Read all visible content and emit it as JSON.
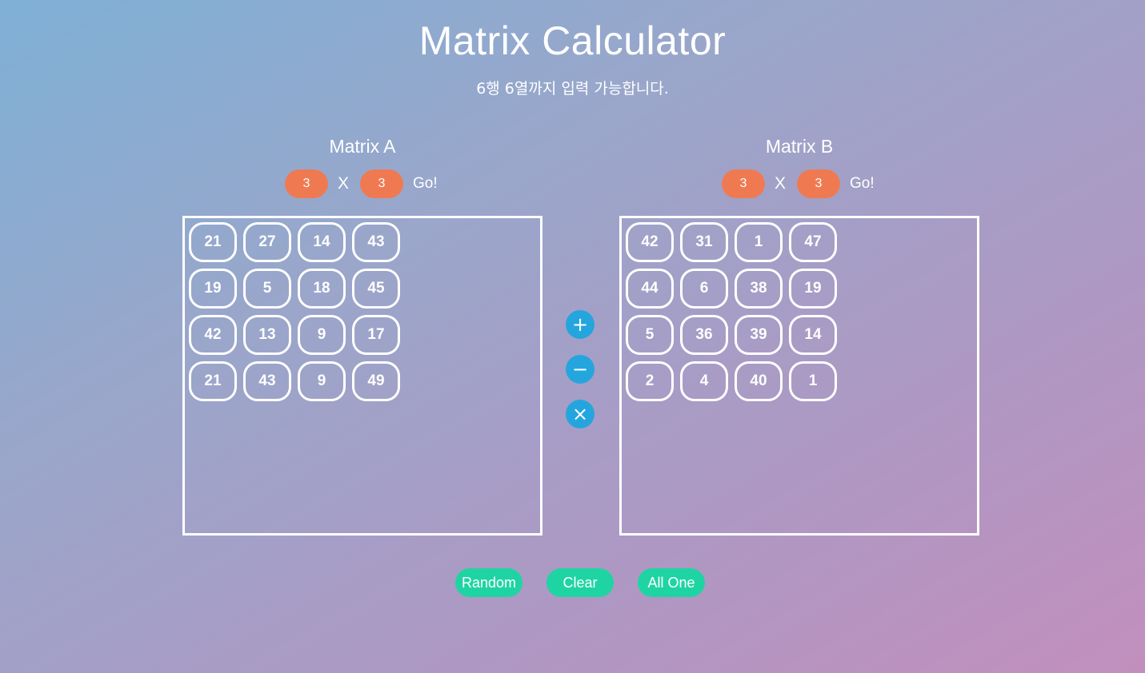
{
  "header": {
    "title": "Matrix Calculator",
    "subtitle": "6행 6열까지 입력 가능합니다."
  },
  "matrix_a": {
    "title": "Matrix A",
    "rows": "3",
    "cols": "3",
    "times": "X",
    "go_label": "Go!",
    "cells": [
      [
        "21",
        "27",
        "14",
        "43"
      ],
      [
        "19",
        "5",
        "18",
        "45"
      ],
      [
        "42",
        "13",
        "9",
        "17"
      ],
      [
        "21",
        "43",
        "9",
        "49"
      ]
    ]
  },
  "matrix_b": {
    "title": "Matrix B",
    "rows": "3",
    "cols": "3",
    "times": "X",
    "go_label": "Go!",
    "cells": [
      [
        "42",
        "31",
        "1",
        "47"
      ],
      [
        "44",
        "6",
        "38",
        "19"
      ],
      [
        "5",
        "36",
        "39",
        "14"
      ],
      [
        "2",
        "4",
        "40",
        "1"
      ]
    ]
  },
  "operations": {
    "add": "+",
    "subtract": "−",
    "multiply": "×"
  },
  "actions": {
    "random": "Random",
    "clear": "Clear",
    "all_one": "All One"
  },
  "colors": {
    "pill": "#ef7a52",
    "op_button": "#25a5de",
    "action_button": "#1fd4a3"
  }
}
